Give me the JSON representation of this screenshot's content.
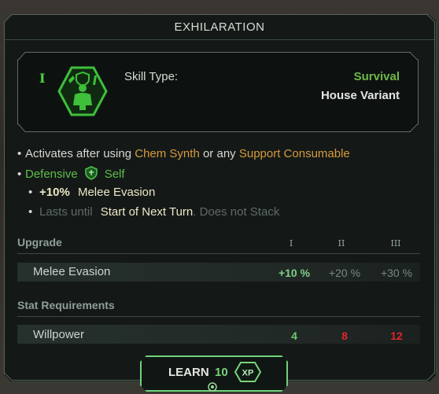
{
  "title": "EXHILARATION",
  "skill": {
    "rank": "I",
    "type_label": "Skill Type:",
    "type_value": "Survival",
    "variant": "House Variant"
  },
  "description": {
    "line1_prefix": "Activates after using",
    "line1_item1": "Chem Synth",
    "line1_middle": "or any",
    "line1_item2": "Support Consumable",
    "line2_label": "Defensive",
    "line2_target": "Self",
    "line3_value": "+10%",
    "line3_stat": "Melee Evasion",
    "line4_prefix": "Lasts until",
    "line4_value": "Start of Next Turn",
    "line4_suffix": ". Does not Stack"
  },
  "upgrade": {
    "header": "Upgrade",
    "tiers": [
      "I",
      "II",
      "III"
    ],
    "row_label": "Melee Evasion",
    "values": [
      "+10 %",
      "+20 %",
      "+30 %"
    ]
  },
  "requirements": {
    "header": "Stat Requirements",
    "row_label": "Willpower",
    "values": [
      "4",
      "8",
      "12"
    ]
  },
  "learn": {
    "label": "LEARN",
    "cost": "10",
    "currency": "XP"
  },
  "colors": {
    "accent_green": "#5fbd4a",
    "orange": "#d69a3e",
    "requirement_met": "#6fc66b",
    "requirement_unmet": "#e0252b"
  },
  "icons": {
    "skill": "survival-figure-icon",
    "defensive": "shield-icon",
    "currency": "xp-hex-icon"
  }
}
